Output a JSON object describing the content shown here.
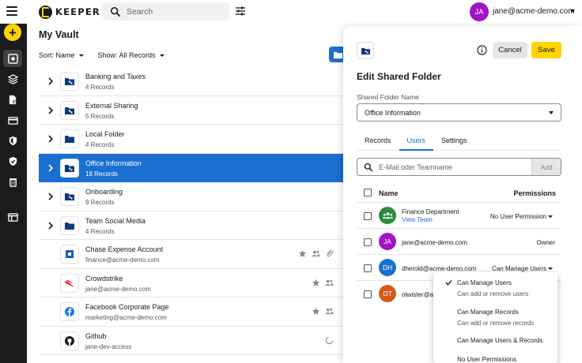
{
  "header": {
    "logo_text": "KEEPER",
    "search_placeholder": "Search",
    "user_initials": "JA",
    "user_email": "jane@acme-demo.com"
  },
  "rail": {
    "add_label": "+",
    "items": [
      "vault-icon",
      "layers-icon",
      "file-lock-icon",
      "card-icon",
      "shield-icon",
      "shield-check-icon",
      "trash-icon",
      "window-icon"
    ]
  },
  "vault": {
    "title": "My Vault",
    "sort_label": "Sort: Name",
    "show_label": "Show: All Records",
    "rows": [
      {
        "name": "Banking and Taxes",
        "sub": "4 Records",
        "type": "shared-folder"
      },
      {
        "name": "External Sharing",
        "sub": "5 Records",
        "type": "shared-folder"
      },
      {
        "name": "Local Folder",
        "sub": "4 Records",
        "type": "folder"
      },
      {
        "name": "Office Information",
        "sub": "18 Records",
        "type": "shared-folder",
        "selected": true
      },
      {
        "name": "Onboarding",
        "sub": "9 Records",
        "type": "shared-folder"
      },
      {
        "name": "Team Social Media",
        "sub": "4 Records",
        "type": "folder"
      },
      {
        "name": "Chase Expense Account",
        "sub": "finance@acme-demo.com",
        "type": "record",
        "icon": "chase-logo-icon"
      },
      {
        "name": "Crowdstrike",
        "sub": "jane@acme-demo.com",
        "type": "record",
        "icon": "crowdstrike-logo-icon"
      },
      {
        "name": "Facebook Corporate Page",
        "sub": "marketing@acme-demo.com",
        "type": "record",
        "icon": "facebook-logo-icon"
      },
      {
        "name": "Github",
        "sub": "jane-dev-access",
        "type": "record",
        "icon": "github-logo-icon"
      }
    ]
  },
  "panel": {
    "title": "Edit Shared Folder",
    "cancel_label": "Cancel",
    "save_label": "Save",
    "field_label": "Shared Folder Name",
    "folder_name": "Office Information",
    "tabs": [
      {
        "label": "Records"
      },
      {
        "label": "Users",
        "active": true
      },
      {
        "label": "Settings"
      }
    ],
    "user_search_placeholder": "E-Mail oder Teamname",
    "add_label": "Add",
    "col_name": "Name",
    "col_permissions": "Permissions",
    "users": [
      {
        "initials": "",
        "name": "Finance Department",
        "link": "View Team",
        "permission": "No User Permission",
        "color": "#2e8b3e",
        "dropdown": true
      },
      {
        "initials": "JA",
        "name": "jane@acme-demo.com",
        "permission": "Owner",
        "color": "#a113c6",
        "dropdown": false
      },
      {
        "initials": "DH",
        "name": "dherold@acme-demo.com",
        "permission": "Can Manage Users",
        "color": "#1a6fd1",
        "dropdown": true
      },
      {
        "initials": "OT",
        "name": "otwister@a",
        "permission": "",
        "color": "#d7581a",
        "dropdown": false
      }
    ]
  },
  "permission_menu": {
    "items": [
      {
        "label": "Can Manage Users",
        "desc": "Can add or remove users",
        "checked": true
      },
      {
        "label": "Can Manage Records",
        "desc": "Can add or remove records",
        "checked": false
      },
      {
        "label": "Can Manage Users & Records",
        "desc": "",
        "checked": false
      },
      {
        "label": "No User Permissions",
        "desc": "",
        "checked": false
      }
    ]
  },
  "colors": {
    "accent": "#1a6fd1",
    "brand_yellow": "#ffd400",
    "rail": "#1b1b1b"
  }
}
